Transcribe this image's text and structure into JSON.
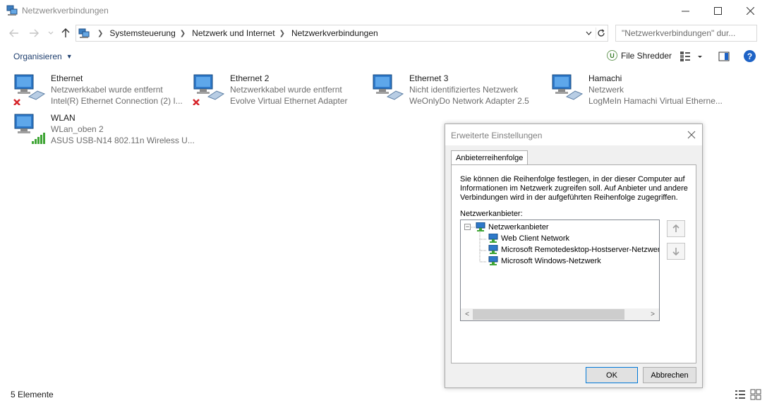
{
  "window": {
    "title": "Netzwerkverbindungen",
    "icons": {
      "app": "network-connections-icon",
      "minimize": "minimize-icon",
      "maximize": "maximize-icon",
      "close": "close-icon"
    }
  },
  "address": {
    "breadcrumbs": [
      "Systemsteuerung",
      "Netzwerk und Internet",
      "Netzwerkverbindungen"
    ],
    "search_placeholder": "\"Netzwerkverbindungen\" dur..."
  },
  "toolbar": {
    "organize_label": "Organisieren",
    "file_shredder_label": "File Shredder",
    "help_label": "?"
  },
  "items": [
    {
      "name": "Ethernet",
      "status": "Netzwerkkabel wurde entfernt",
      "device": "Intel(R) Ethernet Connection (2) I...",
      "state": "disconnected"
    },
    {
      "name": "Ethernet 2",
      "status": "Netzwerkkabel wurde entfernt",
      "device": "Evolve Virtual Ethernet Adapter",
      "state": "disconnected"
    },
    {
      "name": "Ethernet 3",
      "status": "Nicht identifiziertes Netzwerk",
      "device": "WeOnlyDo Network Adapter 2.5",
      "state": "connected"
    },
    {
      "name": "Hamachi",
      "status": "Netzwerk",
      "device": "LogMeIn Hamachi Virtual Etherne...",
      "state": "connected"
    },
    {
      "name": "WLAN",
      "status": "WLan_oben 2",
      "device": "ASUS USB-N14 802.11n Wireless U...",
      "state": "wifi"
    }
  ],
  "dialog": {
    "title": "Erweiterte Einstellungen",
    "tab_label": "Anbieterreihenfolge",
    "description": "Sie können die Reihenfolge festlegen, in der dieser Computer auf Informationen im Netzwerk zugreifen soll. Auf Anbieter und andere Verbindungen wird in der aufgeführten Reihenfolge zugegriffen.",
    "list_label": "Netzwerkanbieter:",
    "tree_root": "Netzwerkanbieter",
    "tree_expander": "−",
    "providers": [
      "Web Client Network",
      "Microsoft Remotedesktop-Hostserver-Netzwerk",
      "Microsoft Windows-Netzwerk"
    ],
    "ok_label": "OK",
    "cancel_label": "Abbrechen",
    "scroll_left": "<",
    "scroll_right": ">"
  },
  "status": {
    "count": "5 Elemente"
  },
  "colors": {
    "accent": "#0078d7",
    "link": "#1e3e6e",
    "help": "#1e63c6",
    "disconnected": "#d6252b",
    "wifi": "#3fa535"
  }
}
